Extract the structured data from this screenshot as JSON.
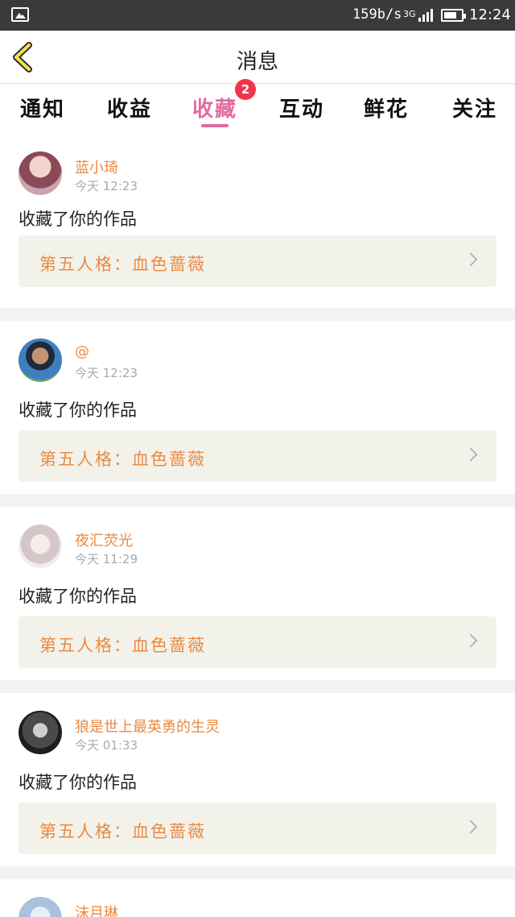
{
  "status_bar": {
    "speed": "159b/s",
    "network": "3G",
    "time": "12:24",
    "icons": [
      "gallery-icon",
      "signal-icon",
      "battery-icon"
    ]
  },
  "header": {
    "title": "消息",
    "back_icon": "chevron-left-icon"
  },
  "tabs": [
    {
      "label": "通知"
    },
    {
      "label": "收益"
    },
    {
      "label": "收藏",
      "active": true,
      "badge": "2"
    },
    {
      "label": "互动"
    },
    {
      "label": "鲜花"
    },
    {
      "label": "关注"
    }
  ],
  "colors": {
    "accent": "#e16aa0",
    "username": "#e98a44",
    "badge": "#f0354b"
  },
  "messages": [
    {
      "user": "蓝小琦",
      "time": "今天 12:23",
      "action": "收藏了你的作品",
      "work": "第五人格：血色蔷薇"
    },
    {
      "user": "@",
      "time": "今天 12:23",
      "action": "收藏了你的作品",
      "work": "第五人格：血色蔷薇"
    },
    {
      "user": "夜汇荧光",
      "time": "今天 11:29",
      "action": "收藏了你的作品",
      "work": "第五人格：血色蔷薇"
    },
    {
      "user": "狼是世上最英勇的生灵",
      "time": "今天 01:33",
      "action": "收藏了你的作品",
      "work": "第五人格：血色蔷薇"
    },
    {
      "user": "沫月琳"
    }
  ]
}
